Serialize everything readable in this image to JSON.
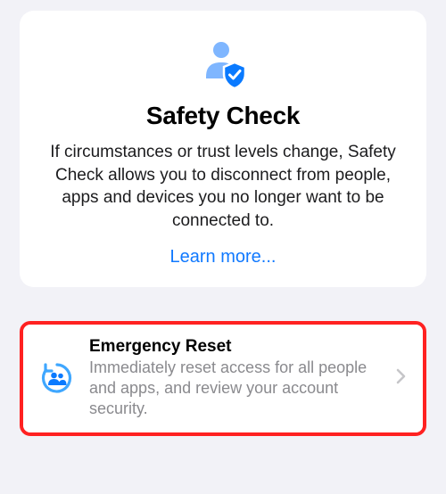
{
  "safetyCard": {
    "title": "Safety Check",
    "description": "If circumstances or trust levels change, Safety Check allows you to disconnect from people, apps and devices you no longer want to be connected to.",
    "learnMore": "Learn more..."
  },
  "emergencyReset": {
    "title": "Emergency Reset",
    "subtitle": "Immediately reset access for all people and apps, and review your account security."
  },
  "colors": {
    "personLight": "#7fb6ff",
    "shieldBlue": "#0a7aff",
    "link": "#1079ff",
    "highlight": "#ff2121",
    "resetIcon": "#3fa7ff"
  }
}
